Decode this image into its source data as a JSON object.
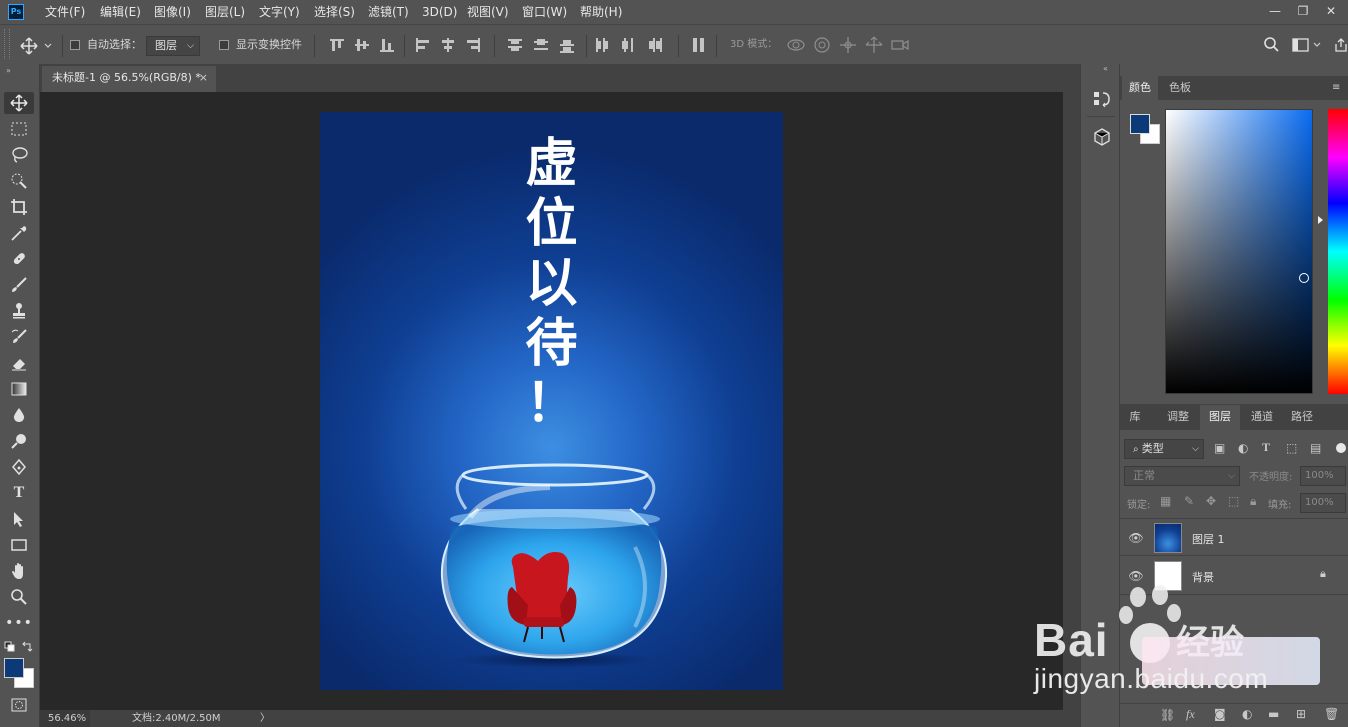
{
  "app": {
    "logo": "Ps"
  },
  "menu": [
    "文件(F)",
    "编辑(E)",
    "图像(I)",
    "图层(L)",
    "文字(Y)",
    "选择(S)",
    "滤镜(T)",
    "3D(D)",
    "视图(V)",
    "窗口(W)",
    "帮助(H)"
  ],
  "window_controls": {
    "minimize": "—",
    "restore": "❐",
    "close": "✕"
  },
  "options": {
    "move_tool_icon": "move-icon",
    "auto_select_label": "自动选择：",
    "auto_select_checked": false,
    "auto_select_target": "图层",
    "show_transform_label": "显示变换控件",
    "show_transform_checked": false,
    "mode_3d_label": "3D 模式："
  },
  "document": {
    "tab_title": "未标题-1 @ 56.5%(RGB/8) *",
    "tab_close": "×",
    "poster_text": [
      "虚",
      "位",
      "以",
      "待",
      "！"
    ]
  },
  "status": {
    "zoom": "56.46%",
    "doc_size": "文档:2.40M/2.50M",
    "arrow": "〉"
  },
  "colors": {
    "foreground": "#0c3a78",
    "background": "#ffffff",
    "accent": "#31a8ff"
  },
  "panels": {
    "color_tabs": [
      "颜色",
      "色板"
    ],
    "layer_tabs": [
      "库",
      "调整",
      "图层",
      "通道",
      "路径"
    ],
    "filter_kind": "类型",
    "blend_mode": "正常",
    "opacity_label": "不透明度:",
    "opacity_value": "100%",
    "lock_label": "锁定:",
    "fill_label": "填充:",
    "fill_value": "100%",
    "layers": [
      {
        "name": "图层 1",
        "visible": true,
        "locked": false
      },
      {
        "name": "背景",
        "visible": true,
        "locked": true
      }
    ]
  },
  "watermark": {
    "brand": "Bai",
    "suffix": "经验",
    "url": "jingyan.baidu.com"
  }
}
